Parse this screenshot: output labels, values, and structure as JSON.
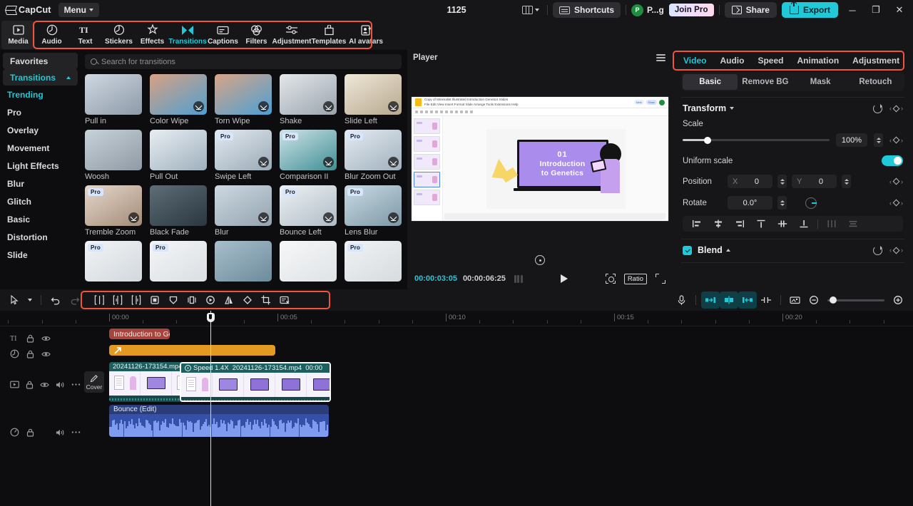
{
  "titlebar": {
    "app_name": "CapCut",
    "menu_label": "Menu",
    "project_title": "1125",
    "shortcuts_label": "Shortcuts",
    "account_initial": "P",
    "account_name": "P...g",
    "join_pro_label": "Join Pro",
    "share_label": "Share",
    "export_label": "Export",
    "minimize": "─",
    "maximize": "❐",
    "close": "✕"
  },
  "toolbar": {
    "tabs": [
      {
        "label": "Media",
        "icon": "media-icon",
        "active": false
      },
      {
        "label": "Audio",
        "icon": "audio-icon",
        "active": false
      },
      {
        "label": "Text",
        "icon": "text-icon",
        "active": false
      },
      {
        "label": "Stickers",
        "icon": "stickers-icon",
        "active": false
      },
      {
        "label": "Effects",
        "icon": "effects-icon",
        "active": false
      },
      {
        "label": "Transitions",
        "icon": "transitions-icon",
        "active": true
      },
      {
        "label": "Captions",
        "icon": "captions-icon",
        "active": false
      },
      {
        "label": "Filters",
        "icon": "filters-icon",
        "active": false
      },
      {
        "label": "Adjustment",
        "icon": "adjustment-icon",
        "active": false
      },
      {
        "label": "Templates",
        "icon": "templates-icon",
        "active": false
      },
      {
        "label": "AI avatars",
        "icon": "ai-avatars-icon",
        "active": false
      }
    ],
    "highlight_color": "#f0543c"
  },
  "sidebar": {
    "items": [
      {
        "label": "Favorites",
        "state": "box"
      },
      {
        "label": "Transitions",
        "state": "selected"
      },
      {
        "label": "Trending",
        "state": "cyan"
      },
      {
        "label": "Pro",
        "state": "normal"
      },
      {
        "label": "Overlay",
        "state": "normal"
      },
      {
        "label": "Movement",
        "state": "normal"
      },
      {
        "label": "Light Effects",
        "state": "normal"
      },
      {
        "label": "Blur",
        "state": "normal"
      },
      {
        "label": "Glitch",
        "state": "normal"
      },
      {
        "label": "Basic",
        "state": "normal"
      },
      {
        "label": "Distortion",
        "state": "normal"
      },
      {
        "label": "Slide",
        "state": "normal"
      }
    ]
  },
  "transitions_panel": {
    "search_placeholder": "Search for transitions",
    "items": [
      {
        "name": "Pull in",
        "pro": false,
        "download": false,
        "c1": "#cfd8e2",
        "c2": "#8d9aa8"
      },
      {
        "name": "Color Wipe",
        "pro": false,
        "download": true,
        "c1": "#d8a184",
        "c2": "#4f9fd0"
      },
      {
        "name": "Torn Wipe",
        "pro": false,
        "download": true,
        "c1": "#d9a486",
        "c2": "#4ba0d4"
      },
      {
        "name": "Shake",
        "pro": false,
        "download": true,
        "c1": "#e4e7ea",
        "c2": "#9aa4ae"
      },
      {
        "name": "Slide Left",
        "pro": false,
        "download": true,
        "c1": "#efe7d8",
        "c2": "#b7a88f"
      },
      {
        "name": "Woosh",
        "pro": false,
        "download": false,
        "c1": "#c8d2da",
        "c2": "#8f9aa4"
      },
      {
        "name": "Pull Out",
        "pro": false,
        "download": false,
        "c1": "#e8eef3",
        "c2": "#9fb0bd"
      },
      {
        "name": "Swipe Left",
        "pro": true,
        "download": true,
        "c1": "#e3eaf0",
        "c2": "#9aaab7"
      },
      {
        "name": "Comparison II",
        "pro": true,
        "download": true,
        "c1": "#cfe3e6",
        "c2": "#3f8f96"
      },
      {
        "name": "Blur Zoom Out",
        "pro": true,
        "download": true,
        "c1": "#e5ebf1",
        "c2": "#a0b1be"
      },
      {
        "name": "Tremble Zoom",
        "pro": true,
        "download": true,
        "c1": "#e6d8cc",
        "c2": "#a38b77"
      },
      {
        "name": "Black Fade",
        "pro": false,
        "download": false,
        "c1": "#5e6d77",
        "c2": "#2a3740"
      },
      {
        "name": "Blur",
        "pro": false,
        "download": true,
        "c1": "#cdd9e2",
        "c2": "#93a3af"
      },
      {
        "name": "Bounce Left",
        "pro": true,
        "download": true,
        "c1": "#eef2f5",
        "c2": "#b0bcc6"
      },
      {
        "name": "Lens Blur",
        "pro": true,
        "download": true,
        "c1": "#c9dbe4",
        "c2": "#7d98a6"
      },
      {
        "name": "",
        "pro": true,
        "download": false,
        "c1": "#f2f4f6",
        "c2": "#d2d8dd"
      },
      {
        "name": "",
        "pro": true,
        "download": false,
        "c1": "#f4f5f7",
        "c2": "#dadfe3"
      },
      {
        "name": "",
        "pro": false,
        "download": false,
        "c1": "#a8bfcc",
        "c2": "#6d8b9b"
      },
      {
        "name": "",
        "pro": false,
        "download": false,
        "c1": "#f6f7f8",
        "c2": "#dfe3e6"
      },
      {
        "name": "",
        "pro": true,
        "download": false,
        "c1": "#f1f3f5",
        "c2": "#d6dbdf"
      }
    ]
  },
  "player": {
    "title": "Player",
    "current_time": "00:00:03:05",
    "total_time": "00:00:06:25",
    "ratio_label": "Ratio",
    "slide": {
      "number": "01",
      "line1": "Introduction",
      "line2": "to Genetics"
    }
  },
  "properties": {
    "tabs": [
      {
        "label": "Video",
        "active": true
      },
      {
        "label": "Audio",
        "active": false
      },
      {
        "label": "Speed",
        "active": false
      },
      {
        "label": "Animation",
        "active": false
      },
      {
        "label": "Adjustment",
        "active": false
      }
    ],
    "more_arrow": "›",
    "subtabs": [
      {
        "label": "Basic",
        "active": true
      },
      {
        "label": "Remove BG",
        "active": false
      },
      {
        "label": "Mask",
        "active": false
      },
      {
        "label": "Retouch",
        "active": false
      }
    ],
    "transform": {
      "title": "Transform",
      "scale_label": "Scale",
      "scale_value": "100%",
      "uniform_label": "Uniform scale",
      "uniform_on": true,
      "position_label": "Position",
      "x_label": "X",
      "x_value": "0",
      "y_label": "Y",
      "y_value": "0",
      "rotate_label": "Rotate",
      "rotate_value": "0.0°"
    },
    "blend": {
      "title": "Blend",
      "enabled": true
    }
  },
  "timeline": {
    "ruler_labels": [
      "00:00",
      "00:05",
      "00:10",
      "00:15",
      "00:20"
    ],
    "tracks": [
      {
        "type": "text",
        "icon": "text-track-icon",
        "controls": [
          "lock-icon",
          "eye-icon"
        ]
      },
      {
        "type": "sticker",
        "icon": "sticker-track-icon",
        "controls": [
          "lock-icon",
          "eye-icon"
        ]
      },
      {
        "type": "video",
        "icon": "video-track-icon",
        "controls": [
          "lock-icon",
          "eye-icon",
          "volume-icon",
          "more-icon"
        ]
      },
      {
        "type": "audio",
        "icon": "audio-track-icon",
        "controls": [
          "lock-icon",
          "volume-icon",
          "more-icon"
        ]
      }
    ],
    "cover_label": "Cover",
    "clips": {
      "text": "Introduction to Ge",
      "video_a": "20241126-173154.mp4",
      "video_b_speed": "Speed 1.4X",
      "video_b_name": "20241126-173154.mp4",
      "video_b_time": "00:00",
      "audio": "Bounce (Edit)"
    }
  }
}
